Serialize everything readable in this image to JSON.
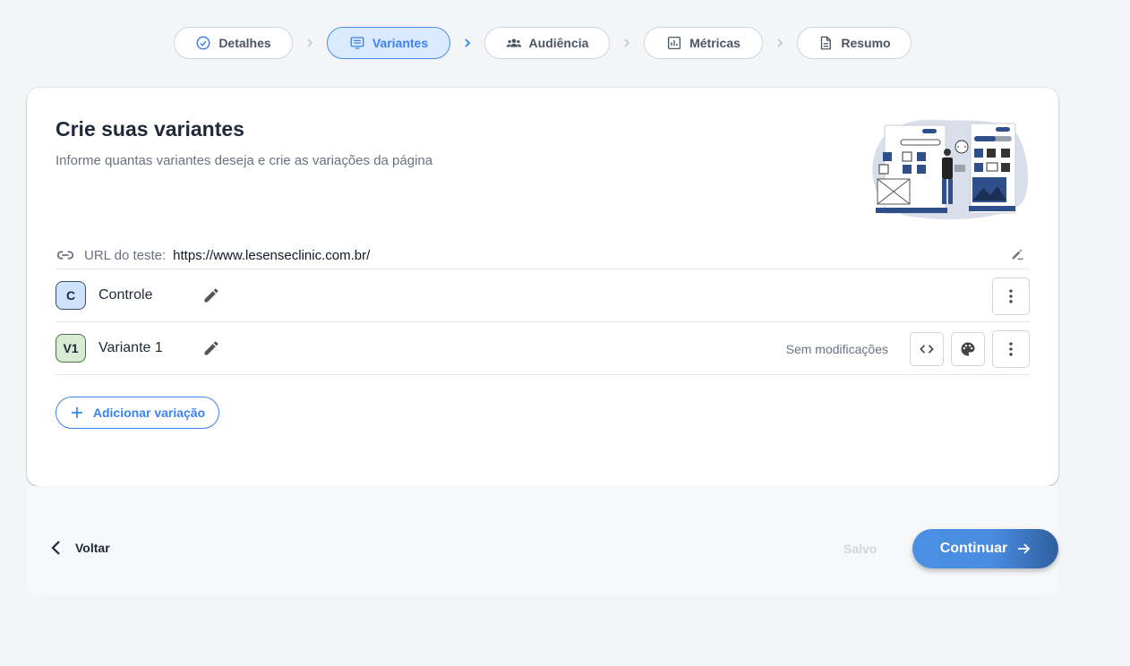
{
  "stepper": {
    "steps": [
      {
        "label": "Detalhes",
        "icon": "check-circle-icon",
        "state": "done"
      },
      {
        "label": "Variantes",
        "icon": "list-icon",
        "state": "active"
      },
      {
        "label": "Audiência",
        "icon": "users-icon",
        "state": "pending"
      },
      {
        "label": "Métricas",
        "icon": "chart-icon",
        "state": "pending"
      },
      {
        "label": "Resumo",
        "icon": "document-icon",
        "state": "pending"
      }
    ]
  },
  "card": {
    "title": "Crie suas variantes",
    "subtitle": "Informe quantas variantes deseja e crie as variações da página",
    "url_label": "URL do teste:",
    "url_value": "https://www.lesenseclinic.com.br/",
    "variants": [
      {
        "badge": "C",
        "name": "Controle",
        "status": ""
      },
      {
        "badge": "V1",
        "name": "Variante 1",
        "status": "Sem modificações"
      }
    ],
    "add_label": "Adicionar variação"
  },
  "footer": {
    "back_label": "Voltar",
    "saved_label": "Salvo",
    "continue_label": "Continuar"
  },
  "colors": {
    "accent": "#3b82f6",
    "active_step_bg": "#dbeafe",
    "control_badge_bg": "#cfe2fb",
    "variant_badge_bg": "#d7ecd2"
  }
}
